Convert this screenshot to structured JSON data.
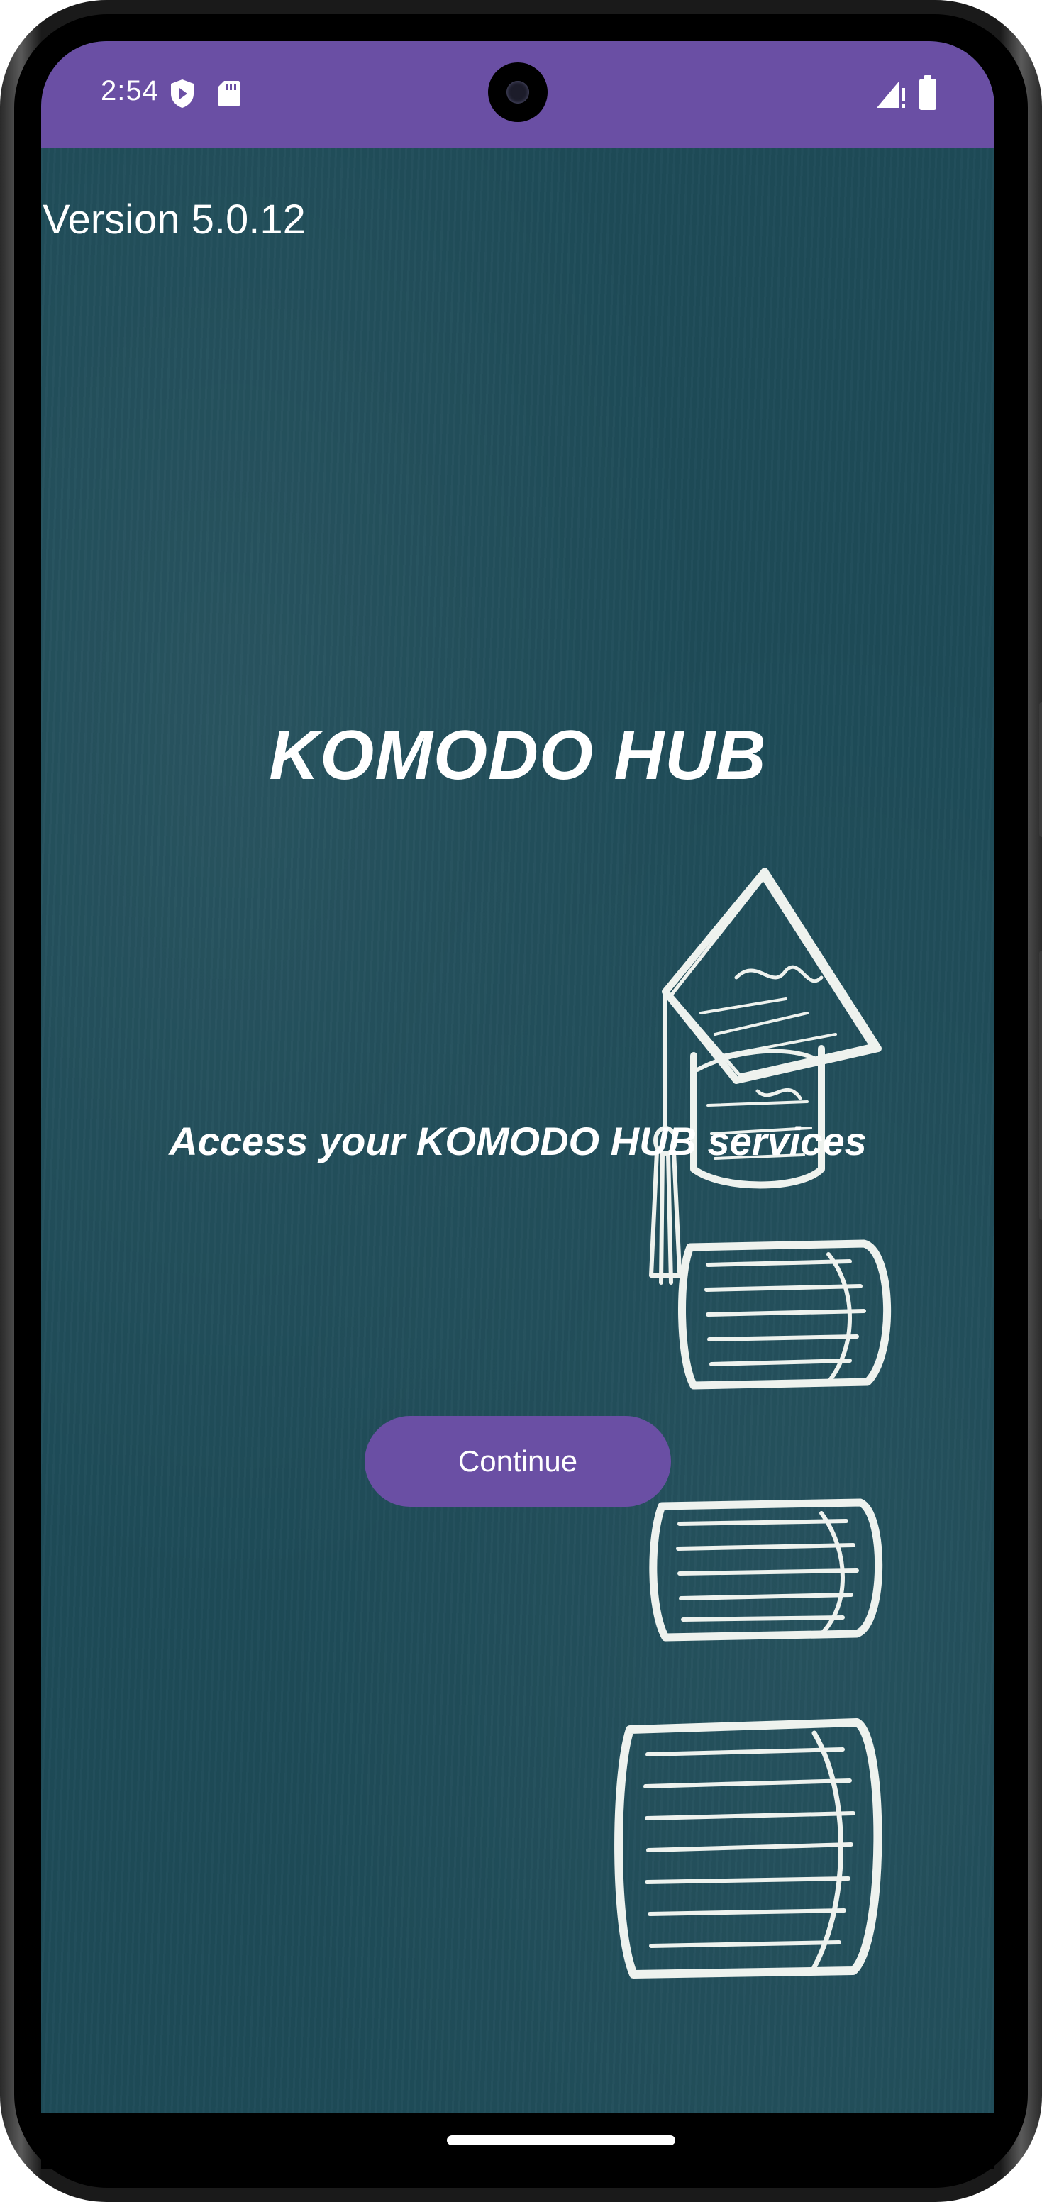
{
  "status_bar": {
    "time": "2:54",
    "left_icons": [
      "shield-play-icon",
      "sd-card-icon"
    ],
    "right_icons": [
      "signal-alert-icon",
      "battery-icon"
    ],
    "color": "#6a4fa4"
  },
  "app": {
    "version_label": "Version 5.0.12",
    "title": "KOMODO HUB",
    "subtitle": "Access your KOMODO HUB services",
    "continue_label": "Continue",
    "background_color": "#1e4b58",
    "accent_color": "#6a4fa4",
    "illustration": "graduation-cap-and-books-icon"
  }
}
